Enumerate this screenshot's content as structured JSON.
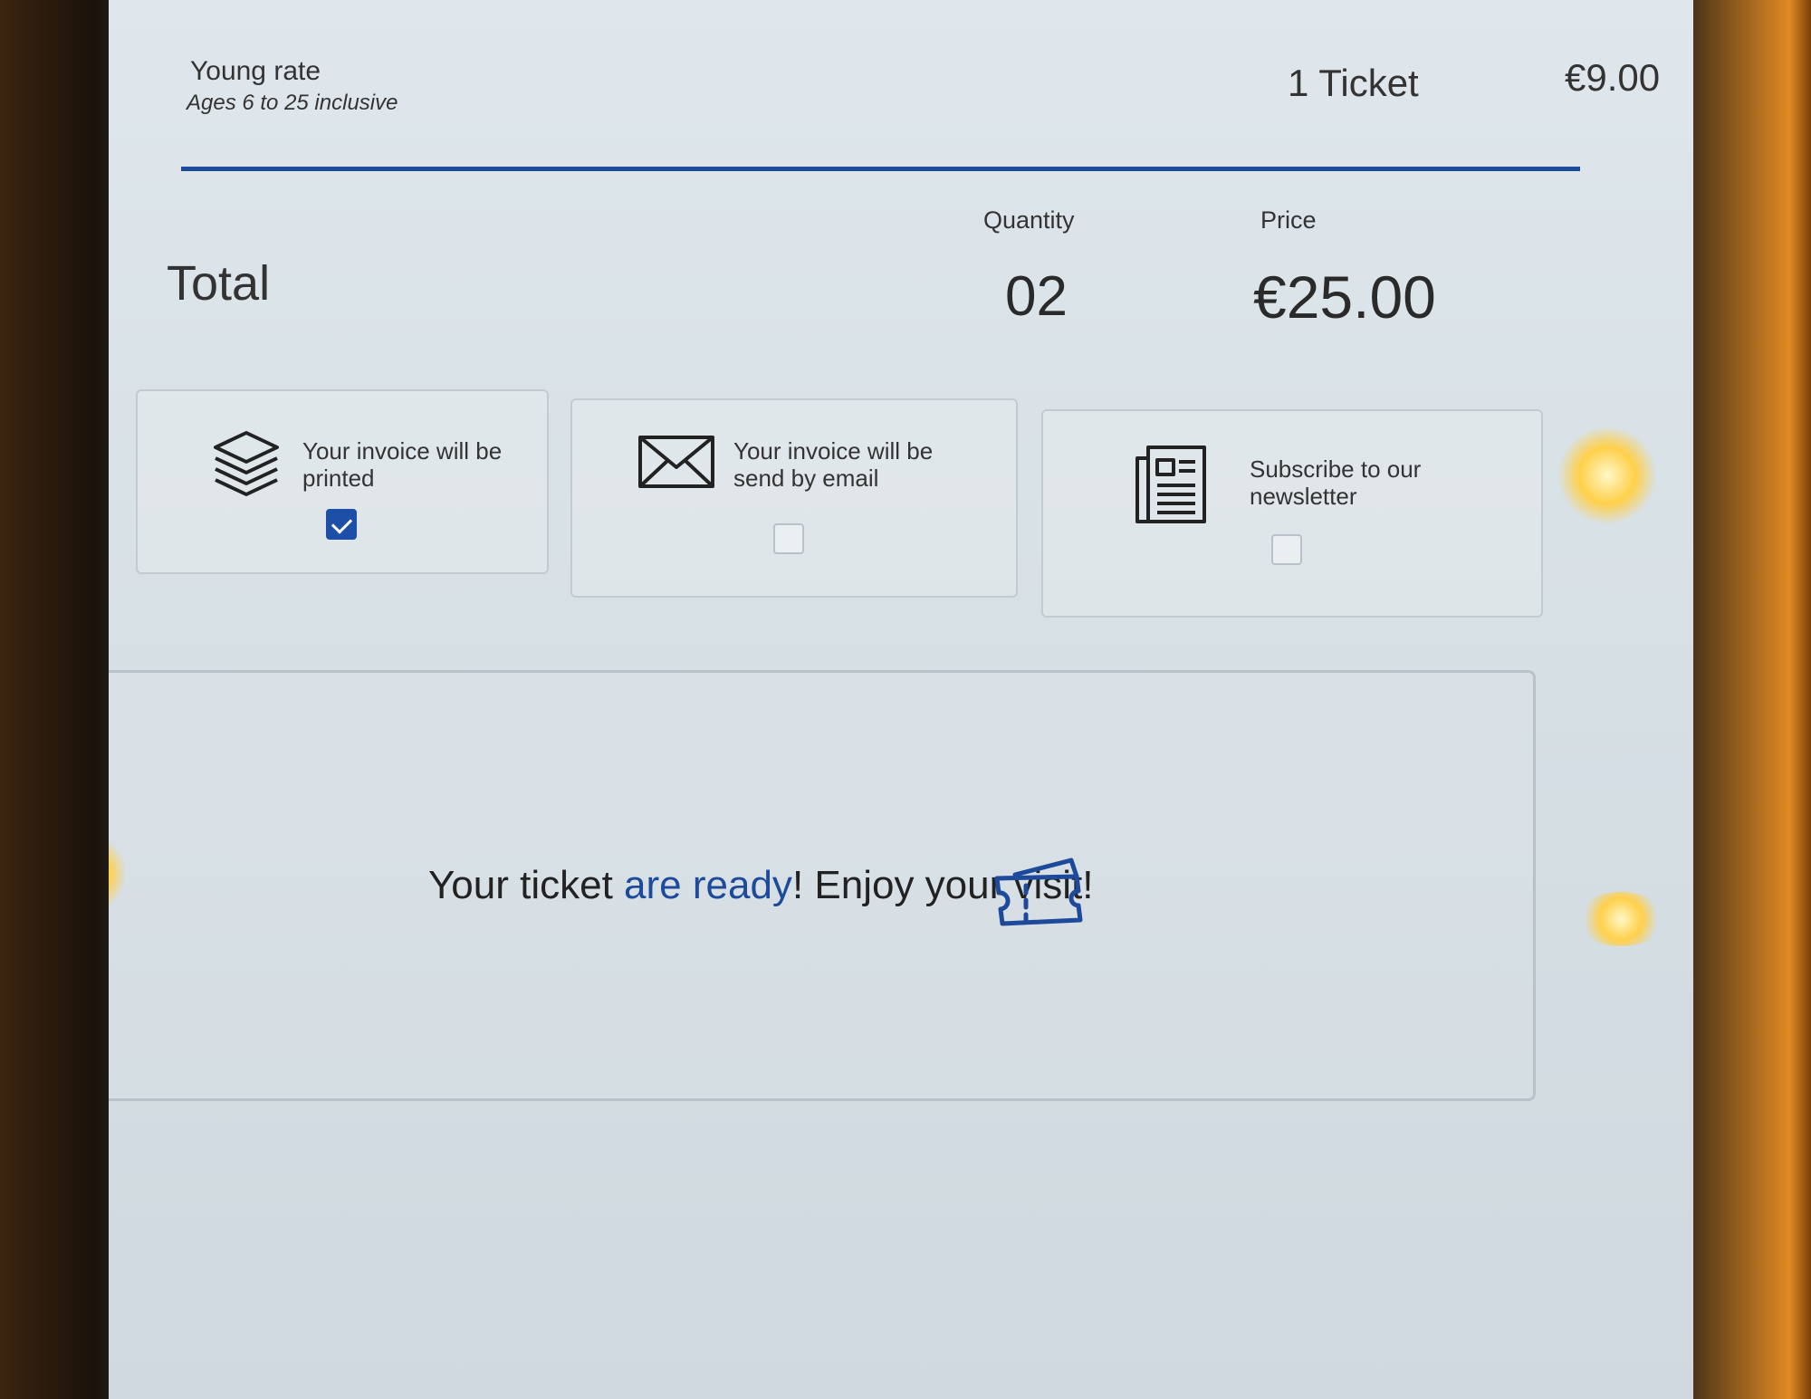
{
  "line_item": {
    "rate_name": "Young rate",
    "rate_subtitle": "Ages 6 to 25 inclusive",
    "quantity": "1 Ticket",
    "price": "€9.00"
  },
  "totals": {
    "quantity_header": "Quantity",
    "price_header": "Price",
    "label": "Total",
    "quantity": "02",
    "price": "€25.00"
  },
  "options": [
    {
      "text": "Your invoice will be printed",
      "icon": "stacked-layers-icon",
      "checked": true
    },
    {
      "text": "Your invoice will be send by email",
      "icon": "envelope-icon",
      "checked": false
    },
    {
      "text": "Subscribe to our newsletter",
      "icon": "newspaper-icon",
      "checked": false
    }
  ],
  "message": {
    "part1": "Your ticket ",
    "accent": "are ready",
    "part2": "! Enjoy your visit!",
    "icon": "ticket-icon"
  },
  "colors": {
    "accent_blue": "#1d4a9a",
    "checkbox_blue": "#1d4fa8",
    "screen_bg": "#d9e2e7"
  }
}
